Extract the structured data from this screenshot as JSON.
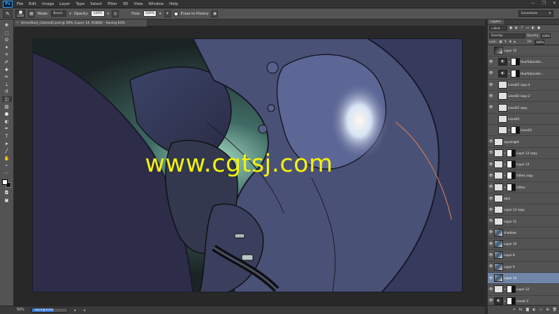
{
  "app": {
    "logo": "Ps",
    "menu": [
      "File",
      "Edit",
      "Image",
      "Layer",
      "Type",
      "Select",
      "Filter",
      "3D",
      "View",
      "Window",
      "Help"
    ],
    "window_controls": [
      "—",
      "❐",
      "✕"
    ]
  },
  "options": {
    "brush_size": "1200",
    "mode_label": "Mode:",
    "mode_value": "Brush",
    "opacity_label": "Opacity:",
    "opacity_value": "100%",
    "flow_label": "Flow:",
    "flow_value": "100%",
    "erase_history_label": "Erase to History",
    "workspace": "Essentials"
  },
  "document": {
    "tab_title": "ArmorBust_Colored2.psd @ 50% (Layer 14, RGB/8) - Saving 63%",
    "watermark": "www.cgtsj.com"
  },
  "status": {
    "zoom": "50%",
    "saving_text": "Saving 63%",
    "saving_progress": 0.63
  },
  "layers_panel": {
    "tab": "Layers",
    "kind_label": "Kind",
    "blend_mode": "Overlay",
    "opacity_label": "Opacity:",
    "opacity_value": "100%",
    "lock_label": "Lock:",
    "fill_label": "Fill:",
    "fill_value": "100%",
    "layers": [
      {
        "name": "Layer 15",
        "visible": false,
        "thumb": "dark",
        "mask": false,
        "indent": false,
        "selected": false
      },
      {
        "name": "Hue/Saturatio...",
        "visible": true,
        "thumb": "adj",
        "mask": true,
        "indent": true,
        "selected": false
      },
      {
        "name": "Hue/Saturatio...",
        "visible": true,
        "thumb": "adj",
        "mask": true,
        "indent": true,
        "selected": false
      },
      {
        "name": "Lines02 copy 4",
        "visible": true,
        "thumb": "check",
        "mask": false,
        "indent": true,
        "selected": false
      },
      {
        "name": "Lines02 copy 2",
        "visible": true,
        "thumb": "check",
        "mask": false,
        "indent": true,
        "selected": false
      },
      {
        "name": "Lines02 copy",
        "visible": true,
        "thumb": "check",
        "mask": false,
        "indent": true,
        "selected": false
      },
      {
        "name": "Lines02",
        "visible": false,
        "thumb": "check",
        "mask": false,
        "indent": true,
        "selected": false
      },
      {
        "name": "Lines01",
        "visible": false,
        "thumb": "check",
        "mask": true,
        "indent": true,
        "selected": false
      },
      {
        "name": "eyeshlight",
        "visible": true,
        "thumb": "check",
        "mask": false,
        "indent": false,
        "selected": false
      },
      {
        "name": "Layer 13 copy",
        "visible": true,
        "thumb": "check",
        "mask": true,
        "indent": false,
        "selected": false
      },
      {
        "name": "Layer 13",
        "visible": true,
        "thumb": "check",
        "mask": true,
        "indent": false,
        "selected": false
      },
      {
        "name": "hilites copy",
        "visible": true,
        "thumb": "check",
        "mask": true,
        "indent": false,
        "selected": false
      },
      {
        "name": "hilites",
        "visible": true,
        "thumb": "check",
        "mask": true,
        "indent": false,
        "selected": false
      },
      {
        "name": "dark",
        "visible": true,
        "thumb": "check",
        "mask": false,
        "indent": false,
        "selected": false
      },
      {
        "name": "Layer 13 copy",
        "visible": true,
        "thumb": "check",
        "mask": false,
        "indent": false,
        "selected": false
      },
      {
        "name": "Layer 11",
        "visible": true,
        "thumb": "check",
        "mask": false,
        "indent": false,
        "selected": false
      },
      {
        "name": "shadows",
        "visible": true,
        "thumb": "art",
        "mask": false,
        "indent": false,
        "selected": false
      },
      {
        "name": "Layer 10",
        "visible": true,
        "thumb": "art",
        "mask": false,
        "indent": false,
        "selected": false
      },
      {
        "name": "Layer 8",
        "visible": true,
        "thumb": "art",
        "mask": false,
        "indent": false,
        "selected": false
      },
      {
        "name": "Layer 9",
        "visible": true,
        "thumb": "art",
        "mask": false,
        "indent": false,
        "selected": false
      },
      {
        "name": "Layer 14",
        "visible": true,
        "thumb": "art",
        "mask": false,
        "indent": false,
        "selected": true
      },
      {
        "name": "Layer 12",
        "visible": true,
        "thumb": "check",
        "mask": true,
        "indent": false,
        "selected": false
      },
      {
        "name": "Levels 2",
        "visible": true,
        "thumb": "adj",
        "mask": true,
        "indent": false,
        "selected": false
      }
    ]
  },
  "colors": {
    "selected_layer": "#6f86a8",
    "watermark": "#f3f20a"
  }
}
